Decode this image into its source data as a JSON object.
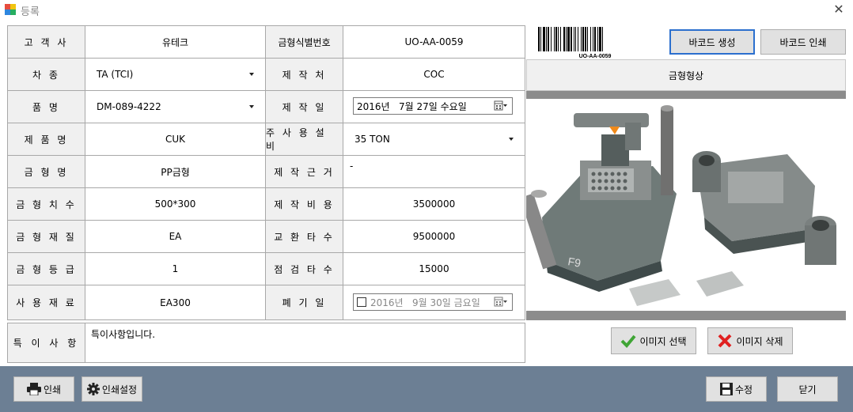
{
  "window": {
    "title": "등록",
    "close_glyph": "✕"
  },
  "form": {
    "customer": {
      "label": "고 객 사",
      "value": "유테크"
    },
    "mold_id": {
      "label": "금형식별번호",
      "value": "UO-AA-0059"
    },
    "car_type": {
      "label": "차 종",
      "value": "TA (TCI)"
    },
    "maker": {
      "label": "제 작 처",
      "value": "COC"
    },
    "part_name": {
      "label": "품 명",
      "value": "DM-089-4222"
    },
    "make_date": {
      "label": "제 작 일",
      "value": "2016년   7월 27일 수요일"
    },
    "product_name": {
      "label": "제 품 명",
      "value": "CUK"
    },
    "main_equipment": {
      "label": "주 사 용 설 비",
      "value": "35 TON"
    },
    "mold_name": {
      "label": "금 형 명",
      "value": "PP금형"
    },
    "make_basis": {
      "label": "제 작 근 거",
      "value": "-"
    },
    "mold_size": {
      "label": "금 형 치 수",
      "value": "500*300"
    },
    "make_cost": {
      "label": "제 작 비 용",
      "value": "3500000"
    },
    "mold_material": {
      "label": "금 형 재 질",
      "value": "EA"
    },
    "exchange_count": {
      "label": "교 환 타 수",
      "value": "9500000"
    },
    "mold_grade": {
      "label": "금 형 등 급",
      "value": "1"
    },
    "inspect_count": {
      "label": "점 검 타 수",
      "value": "15000"
    },
    "use_material": {
      "label": "사 용 재 료",
      "value": "EA300"
    },
    "disposal_date": {
      "label": "폐 기 일",
      "value": "2016년   9월 30일 금요일",
      "checked": false
    },
    "special_note": {
      "label": "특 이 사 항",
      "value": "특이사항입니다."
    }
  },
  "barcode": {
    "text": "UO-AA-0059",
    "generate_label": "바코드 생성",
    "print_label": "바코드 인쇄"
  },
  "image": {
    "header": "금형형상",
    "select_label": "이미지 선택",
    "delete_label": "이미지 삭제"
  },
  "footer": {
    "print_label": "인쇄",
    "print_settings_label": "인쇄설정",
    "edit_label": "수정",
    "close_label": "닫기"
  },
  "colors": {
    "accent": "#2b6fce",
    "footer_bg": "#6c7f94",
    "label_bg": "#f0f0f0",
    "check_green": "#3fa535",
    "delete_red": "#e02020"
  }
}
